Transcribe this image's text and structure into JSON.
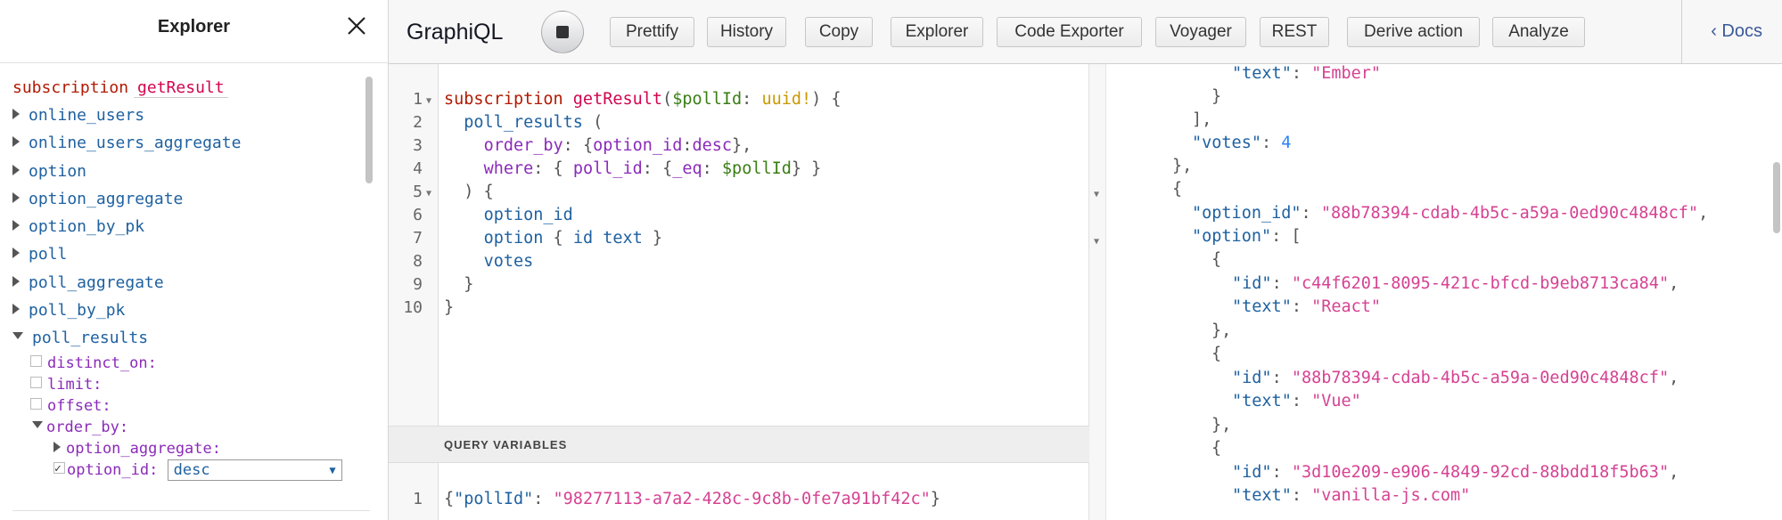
{
  "explorer": {
    "title": "Explorer",
    "operation_keyword": "subscription",
    "operation_name": "getResult",
    "items": [
      "online_users",
      "online_users_aggregate",
      "option",
      "option_aggregate",
      "option_by_pk",
      "poll",
      "poll_aggregate",
      "poll_by_pk"
    ],
    "expanded_item": "poll_results",
    "args": [
      "distinct_on:",
      "limit:",
      "offset:"
    ],
    "order_by_label": "order_by:",
    "option_aggregate_label": "option_aggregate:",
    "option_id_label": "option_id:",
    "order_value": "desc"
  },
  "toolbar": {
    "title": "GraphiQL",
    "buttons": [
      "Prettify",
      "History",
      "Copy",
      "Explorer",
      "Code Exporter",
      "Voyager",
      "REST",
      "Derive action",
      "Analyze"
    ],
    "docs": "Docs"
  },
  "query": {
    "line_numbers": [
      "1",
      "2",
      "3",
      "4",
      "5",
      "6",
      "7",
      "8",
      "9",
      "10"
    ],
    "l1_kw": "subscription",
    "l1_name": "getResult",
    "l1_var": "$pollId",
    "l1_type": "uuid!",
    "l2_field": "poll_results",
    "l3_arg": "order_by",
    "l3_key": "option_id",
    "l3_val": "desc",
    "l4_arg": "where",
    "l4_key": "poll_id",
    "l4_op": "_eq",
    "l4_var": "$pollId",
    "l6_field": "option_id",
    "l7_field": "option",
    "l7_sub1": "id",
    "l7_sub2": "text",
    "l8_field": "votes"
  },
  "variables": {
    "header": "QUERY VARIABLES",
    "line_number": "1",
    "key": "\"pollId\"",
    "value": "\"98277113-a7a2-428c-9c8b-0fe7a91bf42c\""
  },
  "result": {
    "text_key": "\"text\"",
    "votes_key": "\"votes\"",
    "option_id_key": "\"option_id\"",
    "option_key": "\"option\"",
    "id_key": "\"id\"",
    "text_ember": "\"Ember\"",
    "votes_value": "4",
    "option_id_value": "\"88b78394-cdab-4b5c-a59a-0ed90c4848cf\"",
    "id_react": "\"c44f6201-8095-421c-bfcd-b9eb8713ca84\"",
    "text_react": "\"React\"",
    "id_vue": "\"88b78394-cdab-4b5c-a59a-0ed90c4848cf\"",
    "text_vue": "\"Vue\"",
    "id_vanilla": "\"3d10e209-e906-4849-92cd-88bdd18f5b63\"",
    "text_vanilla": "\"vanilla-js.com\""
  }
}
